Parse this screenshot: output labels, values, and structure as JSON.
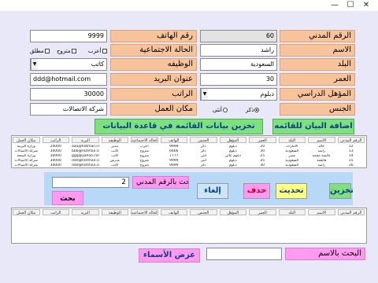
{
  "window": {
    "minimize": "—",
    "maximize": "☐",
    "close": "✕"
  },
  "fields": {
    "civil_id": {
      "label": "الرقم المدني",
      "value": "60"
    },
    "name": {
      "label": "الاسم",
      "value": "راشد"
    },
    "country": {
      "label": "البلد",
      "value": "السعودية"
    },
    "age": {
      "label": "العمر",
      "value": "30"
    },
    "qualification": {
      "label": "المؤهل الدراسي",
      "value": "دبلوم"
    },
    "gender": {
      "label": "الجنس",
      "options": [
        "ذكر",
        "أنثى"
      ],
      "selected": "ذكر"
    },
    "phone": {
      "label": "رقم الهاتف",
      "value": "9999"
    },
    "marital": {
      "label": "الحالة الاجتماعية",
      "options": [
        "أعزب",
        "متزوج",
        "مطلق"
      ],
      "checked": "متزوج"
    },
    "job": {
      "label": "الوظيفه",
      "value": "كاتب"
    },
    "email": {
      "label": "عنوان البريد",
      "value": "ddd@hotmail.com"
    },
    "salary": {
      "label": "الراتب",
      "value": "30000"
    },
    "workplace": {
      "label": "مكان العمل",
      "value": "شركة الاتصالات"
    }
  },
  "buttons": {
    "add": "اضافة البيان للقائمه",
    "save_db": "تخزين بيانات القائمه  في قاعدة البيانات",
    "store": "تخزين",
    "update": "تحديث",
    "delete": "حذف",
    "cancel": "إلغاء",
    "search": "بحث",
    "show_names": "عرض الأسماء"
  },
  "search": {
    "by_id_label": "البحث بالرقم المدني",
    "by_id_value": "2",
    "by_name_label": "البحث بالاسم",
    "by_name_value": ""
  },
  "grid_headers": [
    "الرقم المدني",
    "الاسم",
    "البلد",
    "العمر",
    "المؤهل",
    "الجنس",
    "الهاتف",
    "الحالة الاجتماعية",
    "الوظيفه",
    "البريد",
    "الراتب",
    "مكان العمل"
  ],
  "grid_rows": [
    [
      "12",
      "خالد",
      "الامارات",
      "20",
      "دبلوم",
      "ذكر",
      "9999",
      "أعزب",
      "مدير",
      "aaa@hotmail.com",
      "20000",
      "وزارة التربية"
    ],
    [
      "13",
      "راشد",
      "السعودية",
      "30",
      "دبلوم",
      "ذكر",
      "6666",
      "متزوج",
      "كاتب",
      "bbb@hotmail.com",
      "30000",
      "شركة الاتصالات"
    ],
    [
      "14",
      "عائشه محمد",
      "مصر",
      "25",
      "دبلوم عالي",
      "أنثى",
      "7777",
      "متزوج",
      "كاتب",
      "ggg@yahoo.com",
      "30000",
      "وزارة الصحة"
    ],
    [
      "15",
      "فاطمة",
      "السعودية",
      "35",
      "دبلوم",
      "أنثى",
      "9999",
      "متزوج",
      "مدرس",
      "ddd@hotmail.com",
      "30000",
      "شركة الاتصالات"
    ],
    [
      "16",
      "راشد",
      "السعودية",
      "30",
      "دبلوم",
      "ذكر",
      "9999",
      "متزوج",
      "كاتب",
      "ddd@hotmail.com",
      "30000",
      "شركة الاتصالات"
    ]
  ]
}
